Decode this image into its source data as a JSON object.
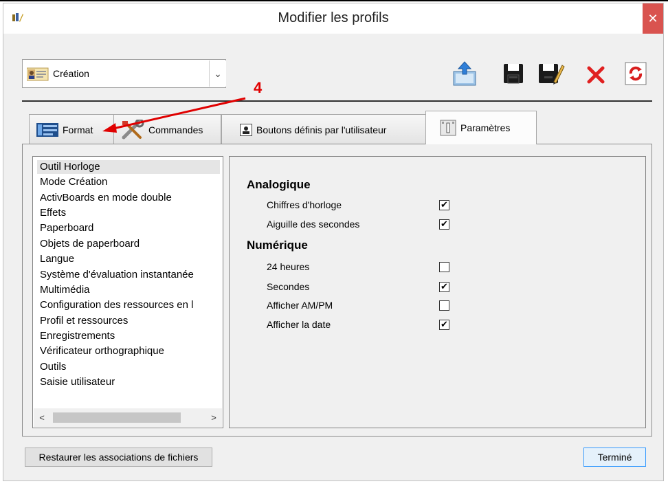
{
  "window": {
    "title": "Modifier les profils"
  },
  "profile": {
    "selected": "Création"
  },
  "annotation": {
    "number": "4"
  },
  "toolbar": {
    "icons": [
      "export-icon",
      "save-icon",
      "save-as-icon",
      "delete-icon",
      "refresh-icon"
    ]
  },
  "tabs": [
    {
      "label": "Format",
      "icon": "format-icon"
    },
    {
      "label": "Commandes",
      "icon": "tools-icon"
    },
    {
      "label": "Boutons définis par l'utilisateur",
      "icon": "user-icon"
    },
    {
      "label": "Paramètres",
      "icon": "settings-icon",
      "active": true
    }
  ],
  "categories": [
    "Outil Horloge",
    "Mode Création",
    "ActivBoards en mode double",
    "Effets",
    "Paperboard",
    "Objets de paperboard",
    "Langue",
    "Système d'évaluation instantanée",
    "Multimédia",
    "Configuration des ressources en l",
    "Profil et ressources",
    "Enregistrements",
    "Vérificateur orthographique",
    "Outils",
    "Saisie utilisateur"
  ],
  "settings": {
    "analog": {
      "title": "Analogique",
      "options": [
        {
          "label": "Chiffres d'horloge",
          "checked": true
        },
        {
          "label": "Aiguille des secondes",
          "checked": true
        }
      ]
    },
    "digital": {
      "title": "Numérique",
      "options": [
        {
          "label": "24 heures",
          "checked": false
        },
        {
          "label": "Secondes",
          "checked": true
        },
        {
          "label": "Afficher AM/PM",
          "checked": false
        },
        {
          "label": "Afficher la date",
          "checked": true
        }
      ]
    }
  },
  "buttons": {
    "restore": "Restaurer les associations de fichiers",
    "done": "Terminé"
  },
  "colors": {
    "annotation": "#e00000",
    "close": "#d9534f",
    "delete": "#e02020",
    "refresh": "#d81e1e"
  }
}
